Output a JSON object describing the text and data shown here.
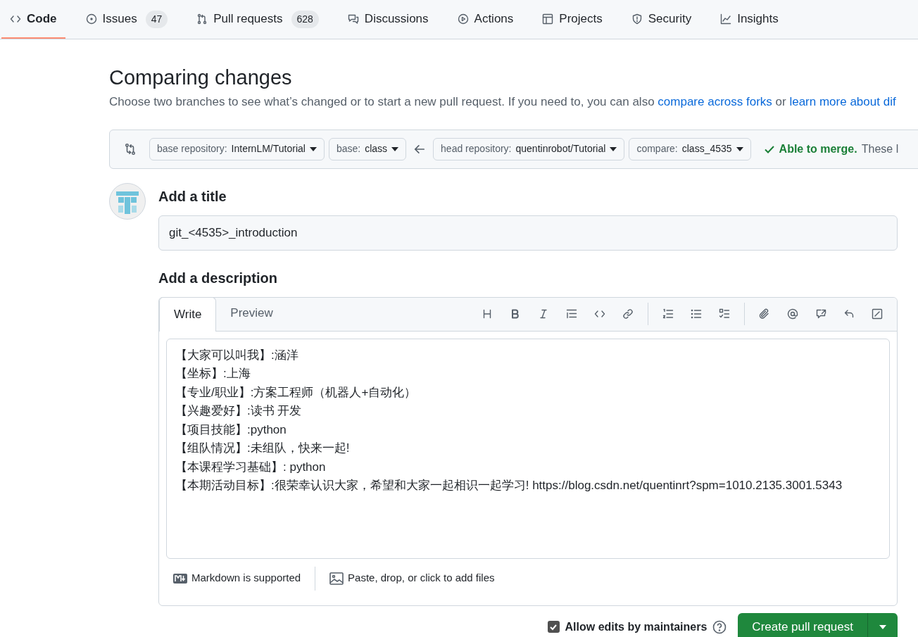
{
  "repo_tabs": [
    {
      "label": "Code",
      "selected": true
    },
    {
      "label": "Issues",
      "count": "47",
      "selected": false
    },
    {
      "label": "Pull requests",
      "count": "628",
      "selected": false
    },
    {
      "label": "Discussions",
      "selected": false
    },
    {
      "label": "Actions",
      "selected": false
    },
    {
      "label": "Projects",
      "selected": false
    },
    {
      "label": "Security",
      "selected": false
    },
    {
      "label": "Insights",
      "selected": false
    }
  ],
  "heading": "Comparing changes",
  "subtitle": {
    "text": "Choose two branches to see what’s changed or to start a new pull request. If you need to, you can also",
    "link1": "compare across forks",
    "between": "or",
    "link2": "learn more about dif"
  },
  "compare_bar": {
    "base_repository": {
      "label": "base repository:",
      "value": "InternLM/Tutorial"
    },
    "base": {
      "label": "base:",
      "value": "class"
    },
    "head_repository": {
      "label": "head repository:",
      "value": "quentinrobot/Tutorial"
    },
    "compare": {
      "label": "compare:",
      "value": "class_4535"
    },
    "merge_status": "Able to merge.",
    "merge_note": "These l"
  },
  "title_label": "Add a title",
  "title_value": "git_<4535>_introduction",
  "description_label": "Add a description",
  "editor_tabs": [
    {
      "label": "Write",
      "selected": true
    },
    {
      "label": "Preview",
      "selected": false
    }
  ],
  "description_lines": [
    "【大家可以叫我】:涵洋",
    "【坐标】:上海",
    "【专业/职业】:方案工程师（机器人+自动化）",
    "【兴趣爱好】:读书 开发",
    "【项目技能】:python",
    "【组队情况】:未组队，快来一起!",
    "【本课程学习基础】: python",
    "【本期活动目标】:很荣幸认识大家，希望和大家一起相识一起学习! https://blog.csdn.net/quentinrt?spm=1010.2135.3001.5343"
  ],
  "markdown_note": "Markdown is supported",
  "attach_note": "Paste, drop, or click to add files",
  "allow_edits": {
    "label": "Allow edits by maintainers",
    "checked": true
  },
  "create_button": "Create pull request"
}
